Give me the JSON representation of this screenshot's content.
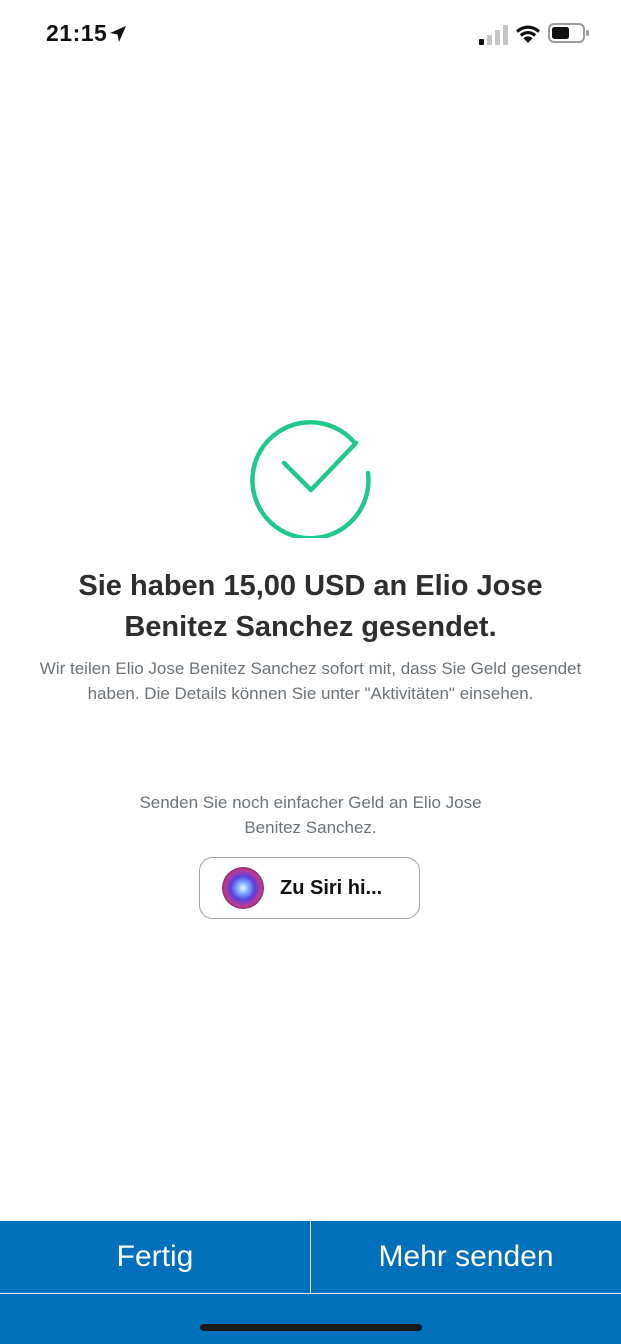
{
  "status_bar": {
    "time": "21:15",
    "icons": [
      "location-arrow-icon",
      "cellular-signal-icon",
      "wifi-icon",
      "battery-icon"
    ]
  },
  "success": {
    "icon": "checkmark-circle-icon",
    "color": "#1ec98a",
    "headline": "Sie haben 15,00 USD an Elio Jose Benitez Sanchez gesendet.",
    "message": "Wir teilen Elio Jose Benitez Sanchez sofort mit, dass Sie Geld gesendet haben. Die Details können Sie unter \"Aktivitäten\" einsehen."
  },
  "siri": {
    "prompt": "Senden Sie noch einfacher Geld an Elio Jose Benitez Sanchez.",
    "button_label": "Zu Siri hi...",
    "icon": "siri-icon"
  },
  "actions": {
    "done_label": "Fertig",
    "send_more_label": "Mehr senden",
    "bar_color": "#0070ba"
  }
}
